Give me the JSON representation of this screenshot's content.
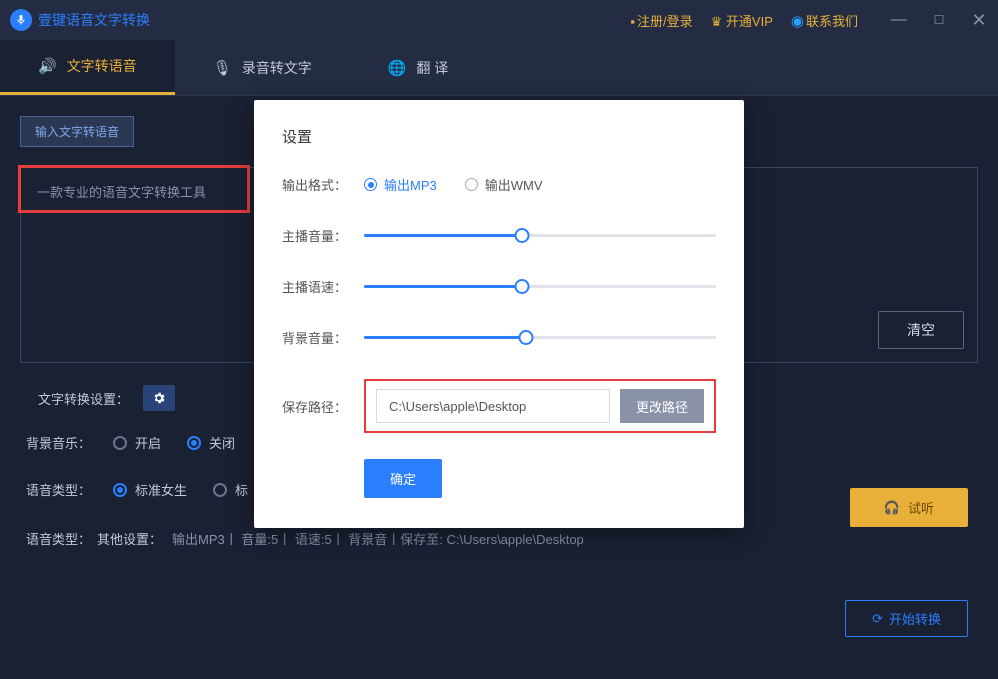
{
  "titlebar": {
    "app_name": "壹键语音文字转换",
    "register_login": "注册/登录",
    "open_vip": "开通VIP",
    "contact_us": "联系我们"
  },
  "tabs": {
    "tts": "文字转语音",
    "stt": "录音转文字",
    "translate": "翻    译"
  },
  "subtab": {
    "input_tts": "输入文字转语音"
  },
  "textarea": {
    "placeholder": "一款专业的语音文字转换工具",
    "clear": "清空"
  },
  "settings_label": "文字转换设置：",
  "bg_music": {
    "label": "背景音乐：",
    "on": "开启",
    "off": "关闭"
  },
  "voice_type": {
    "label": "语音类型：",
    "standard_female": "标准女生",
    "standard_prefix": "标"
  },
  "summary": {
    "label": "语音类型：",
    "other": "其他设置：",
    "value": "输出MP3丨 音量:5丨 语速:5丨 背景音丨保存至: C:\\Users\\apple\\Desktop"
  },
  "preview_btn": "试听",
  "start_btn": "开始转换",
  "modal": {
    "title": "设置",
    "output_format": "输出格式：",
    "output_mp3": "输出MP3",
    "output_wmv": "输出WMV",
    "anchor_volume": "主播音量：",
    "anchor_speed": "主播语速：",
    "bg_volume": "背景音量：",
    "save_path_label": "保存路径：",
    "save_path_value": "C:\\Users\\apple\\Desktop",
    "change_path": "更改路径",
    "confirm": "确定",
    "slider_volume_pct": 45,
    "slider_speed_pct": 45,
    "slider_bg_pct": 46
  }
}
